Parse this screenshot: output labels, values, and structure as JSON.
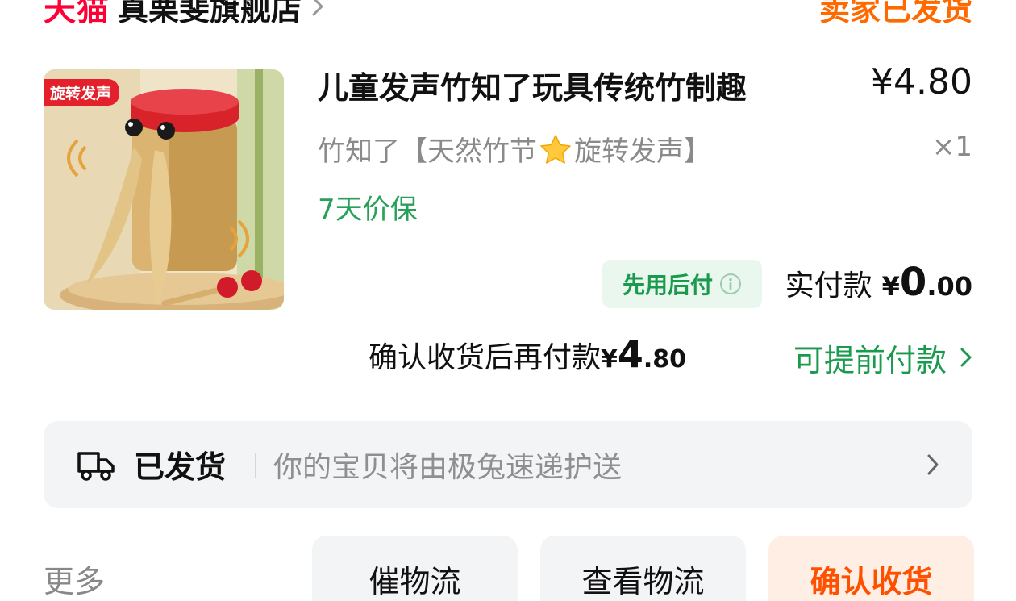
{
  "store": {
    "platform": "天猫",
    "name": "真栗斐旗舰店",
    "order_status": "卖家已发货"
  },
  "product": {
    "badge": "旋转发声",
    "title": "儿童发声竹知了玩具传统竹制趣",
    "price": "¥4.80",
    "sku_prefix": "竹知了【天然竹节",
    "sku_suffix": "旋转发声】",
    "quantity": "×1",
    "price_protection": "7天价保"
  },
  "payment": {
    "pay_later_label": "先用后付",
    "actual_paid_label": "实付款",
    "actual_paid_currency": "¥",
    "actual_paid_int": "0",
    "actual_paid_dec": ".00",
    "confirm_label": "确认收货后再付款",
    "confirm_currency": "¥",
    "confirm_int": "4",
    "confirm_dec": ".80",
    "prepay_link": "可提前付款"
  },
  "shipping": {
    "status": "已发货",
    "description": "你的宝贝将由极兔速递护送"
  },
  "actions": {
    "more": "更多",
    "urge": "催物流",
    "view_logistics": "查看物流",
    "confirm_receipt": "确认收货"
  },
  "colors": {
    "tmall_red": "#ff0036",
    "status_orange": "#ff6a00",
    "green": "#1a9a4c",
    "card_gray": "#f3f4f6"
  }
}
